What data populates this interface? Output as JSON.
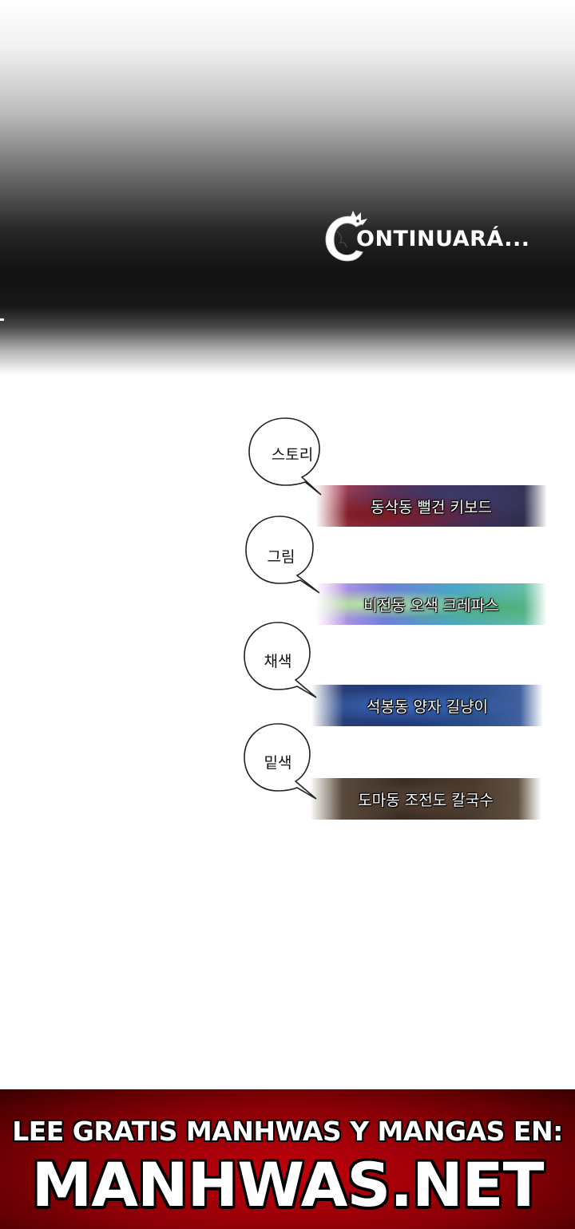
{
  "panel": {
    "continue_text": "ONTINUARÁ...",
    "logo": {
      "icon": "dragon-c-logo",
      "letter": "C"
    }
  },
  "credits": [
    {
      "role": "스토리",
      "credit": "동삭동 뻘건 키보드"
    },
    {
      "role": "그림",
      "credit": "비전동 오색 크레파스"
    },
    {
      "role": "채색",
      "credit": "석봉동 양자 길냥이"
    },
    {
      "role": "밑색",
      "credit": "도마동 조전도 칼국수"
    }
  ],
  "ad": {
    "line1": "LEE GRATIS MANHWAS Y MANGAS EN:",
    "line2": "MANHWAS.NET"
  },
  "colors": {
    "ad_red": "#c4000d",
    "panel_dark": "#121212"
  }
}
